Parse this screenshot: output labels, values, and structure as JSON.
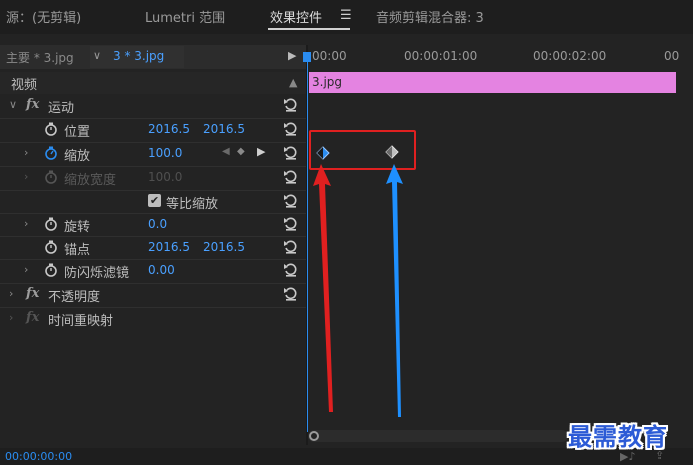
{
  "tabs": [
    {
      "label": "源：(无剪辑)"
    },
    {
      "label": "Lumetri 范围"
    },
    {
      "label": "效果控件"
    },
    {
      "label": "音频剪辑混合器: 3"
    }
  ],
  "panel": {
    "master_label": "主要 * 3.jpg",
    "clip_selector": "3 * 3.jpg"
  },
  "ruler": {
    "t0": "00:00",
    "t1": "00:00:01:00",
    "t2": "00:00:02:00",
    "t3": "00"
  },
  "clip_bar_label": "3.jpg",
  "sections": {
    "video": "视频"
  },
  "motion": {
    "label": "运动",
    "position": {
      "label": "位置",
      "x": "2016.5",
      "y": "2016.5"
    },
    "scale": {
      "label": "缩放",
      "value": "100.0"
    },
    "scale_width": {
      "label": "缩放宽度",
      "value": "100.0"
    },
    "uniform_scale": {
      "label": "等比缩放",
      "checked": true
    },
    "rotation": {
      "label": "旋转",
      "value": "0.0"
    },
    "anchor": {
      "label": "锚点",
      "x": "2016.5",
      "y": "2016.5"
    },
    "anti_flicker": {
      "label": "防闪烁滤镜",
      "value": "0.00"
    }
  },
  "opacity": {
    "label": "不透明度"
  },
  "time_remap": {
    "label": "时间重映射"
  },
  "bottom": {
    "timecode": "00:00:00:00"
  },
  "watermark": "最需教育",
  "colors": {
    "accent_blue": "#2a8cf0",
    "value_blue": "#4aa0ff",
    "clip_pink": "#e483e1",
    "annotation_red": "#e02020",
    "annotation_blue": "#1e90ff"
  }
}
